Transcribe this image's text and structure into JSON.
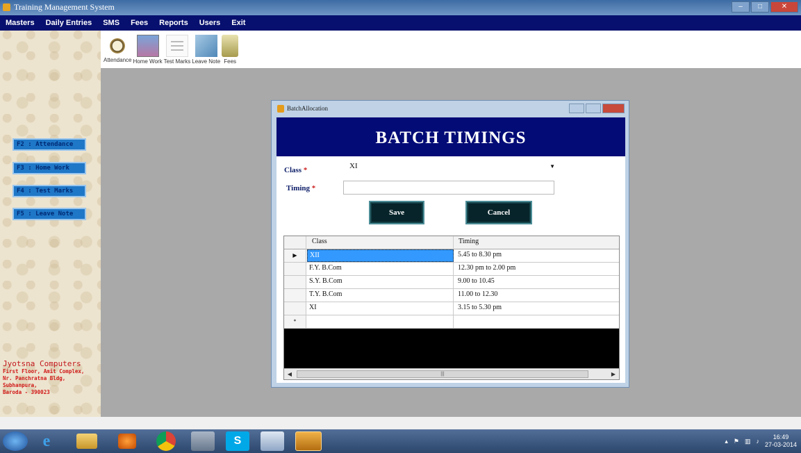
{
  "window": {
    "title": "Training Management System"
  },
  "menu": [
    "Masters",
    "Daily Entries",
    "SMS",
    "Fees",
    "Reports",
    "Users",
    "Exit"
  ],
  "toolbar": {
    "items": [
      {
        "label": "Attendance",
        "icon": "clock-icon"
      },
      {
        "label": "Home Work",
        "icon": "homework-icon"
      },
      {
        "label": "Test Marks",
        "icon": "test-marks-icon"
      },
      {
        "label": "Leave Note",
        "icon": "leave-note-icon"
      },
      {
        "label": "Fees",
        "icon": "fees-icon"
      }
    ]
  },
  "sidebar": {
    "shortcuts": [
      "F2 : Attendance",
      "F3 : Home Work",
      "F4 : Test Marks",
      "F5 : Leave Note"
    ],
    "company": "Jyotsna Computers",
    "address": [
      "First Floor, Amit Complex,",
      "Nr. Panchratna Bldg,",
      "Subhanpura,",
      "Baroda - 390023"
    ]
  },
  "dialog": {
    "title": "BatchAllocation",
    "banner": "BATCH TIMINGS",
    "class_label": "Class",
    "timing_label": "Timing",
    "required_mark": "*",
    "class_value": "XI",
    "timing_value": "",
    "save_label": "Save",
    "cancel_label": "Cancel"
  },
  "grid": {
    "columns": [
      "Class",
      "Timing"
    ],
    "rows": [
      {
        "class": "XII",
        "timing": "5.45 to 8.30 pm",
        "indicator": "▶",
        "selected": true
      },
      {
        "class": "F.Y. B.Com",
        "timing": "12.30 pm to 2.00 pm"
      },
      {
        "class": "S.Y. B.Com",
        "timing": "9.00 to 10.45"
      },
      {
        "class": "T.Y. B.Com",
        "timing": "11.00 to 12.30"
      },
      {
        "class": "XI",
        "timing": "3.15 to 5.30 pm"
      },
      {
        "class": "",
        "timing": "",
        "indicator": "*"
      }
    ]
  },
  "taskbar": {
    "time": "16:49",
    "date": "27-03-2014"
  },
  "colors": {
    "menu_bar": "#07106e",
    "banner": "#020b76",
    "selected_row": "#3399ff",
    "address_text": "#d11818"
  }
}
